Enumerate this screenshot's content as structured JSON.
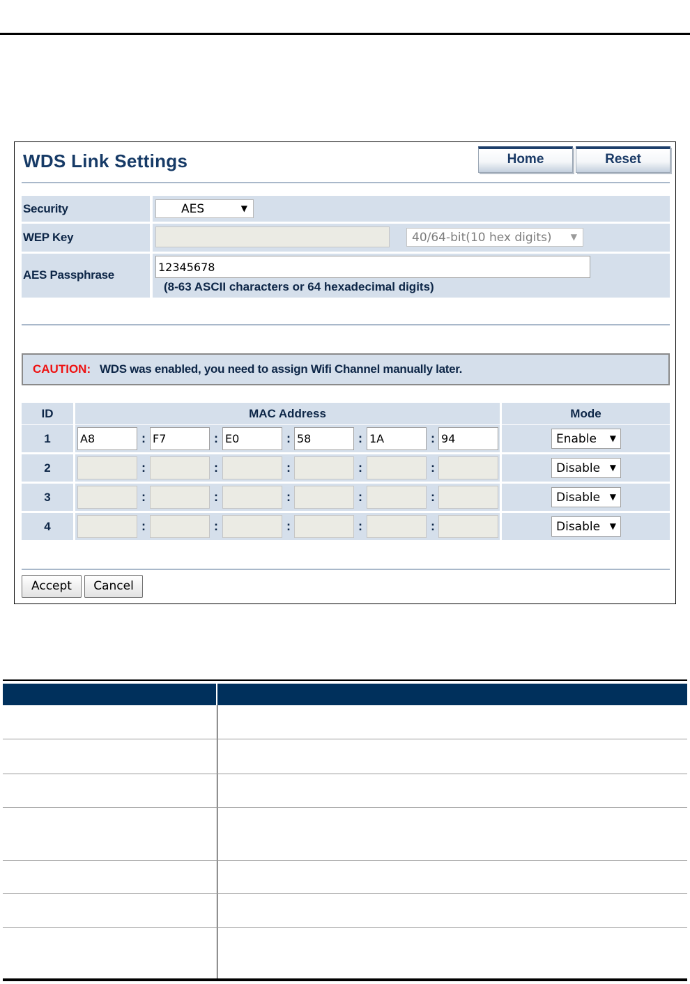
{
  "panel": {
    "title": "WDS Link Settings",
    "home_label": "Home",
    "reset_label": "Reset"
  },
  "security": {
    "label": "Security",
    "value": "AES"
  },
  "wep": {
    "label": "WEP Key",
    "key_value": "",
    "key_length": "40/64-bit(10 hex digits)"
  },
  "aes": {
    "label": "AES Passphrase",
    "value": "12345678",
    "hint": "(8-63 ASCII characters or 64 hexadecimal digits)"
  },
  "caution": {
    "label": "CAUTION:",
    "text": "WDS was enabled, you need to assign Wifi Channel manually later."
  },
  "mac_table": {
    "headers": {
      "id": "ID",
      "mac": "MAC Address",
      "mode": "Mode"
    },
    "rows": [
      {
        "id": "1",
        "mac": [
          "A8",
          "F7",
          "E0",
          "58",
          "1A",
          "94"
        ],
        "mode": "Enable"
      },
      {
        "id": "2",
        "mac": [
          "",
          "",
          "",
          "",
          "",
          ""
        ],
        "mode": "Disable"
      },
      {
        "id": "3",
        "mac": [
          "",
          "",
          "",
          "",
          "",
          ""
        ],
        "mode": "Disable"
      },
      {
        "id": "4",
        "mac": [
          "",
          "",
          "",
          "",
          "",
          ""
        ],
        "mode": "Disable"
      }
    ],
    "separator": ":"
  },
  "buttons": {
    "accept": "Accept",
    "cancel": "Cancel"
  },
  "colors": {
    "title": "#163a66",
    "band": "#d5dfeb",
    "caution": "#ee1111",
    "table_header": "#00305c"
  }
}
